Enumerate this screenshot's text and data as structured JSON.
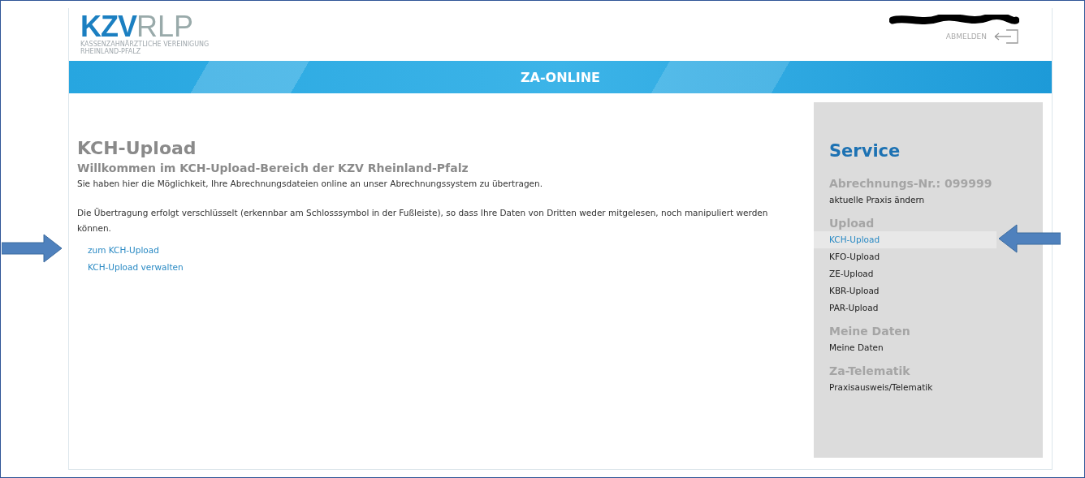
{
  "header": {
    "logo": {
      "bold": "KZV",
      "light": "RLP",
      "subtitle_lines": [
        "KASSENZAHNÄRZTLICHE VEREINIGUNG",
        "RHEINLAND-PFALZ"
      ]
    },
    "user_redacted": true,
    "logout": "ABMELDEN"
  },
  "banner": {
    "title": "ZA-ONLINE"
  },
  "main": {
    "title": "KCH-Upload",
    "subtitle": "Willkommen im KCH-Upload-Bereich der KZV Rheinland-Pfalz",
    "paragraphs": [
      "Sie haben hier die Möglichkeit, Ihre Abrechnungsdateien online an unser Abrechnungssystem zu übertragen.",
      "Die Übertragung erfolgt verschlüsselt (erkennbar am Schlosssymbol in der Fußleiste), so dass Ihre Daten von Dritten weder mitgelesen, noch manipuliert werden können."
    ],
    "links": [
      {
        "label": "zum KCH-Upload",
        "annotated": true
      },
      {
        "label": "KCH-Upload verwalten",
        "annotated": false
      }
    ]
  },
  "sidebar": {
    "title": "Service",
    "groups": [
      {
        "heading": "Abrechnungs-Nr.: 099999",
        "items": [
          {
            "label": "aktuelle Praxis ändern",
            "selected": false,
            "annotated": false
          }
        ]
      },
      {
        "heading": "Upload",
        "items": [
          {
            "label": "KCH-Upload",
            "selected": true,
            "annotated": true
          },
          {
            "label": "KFO-Upload",
            "selected": false,
            "annotated": false
          },
          {
            "label": "ZE-Upload",
            "selected": false,
            "annotated": false
          },
          {
            "label": "KBR-Upload",
            "selected": false,
            "annotated": false
          },
          {
            "label": "PAR-Upload",
            "selected": false,
            "annotated": false
          }
        ]
      },
      {
        "heading": "Meine Daten",
        "items": [
          {
            "label": "Meine Daten",
            "selected": false,
            "annotated": false
          }
        ]
      },
      {
        "heading": "Za-Telematik",
        "items": [
          {
            "label": "Praxisausweis/Telematik",
            "selected": false,
            "annotated": false
          }
        ]
      }
    ]
  }
}
